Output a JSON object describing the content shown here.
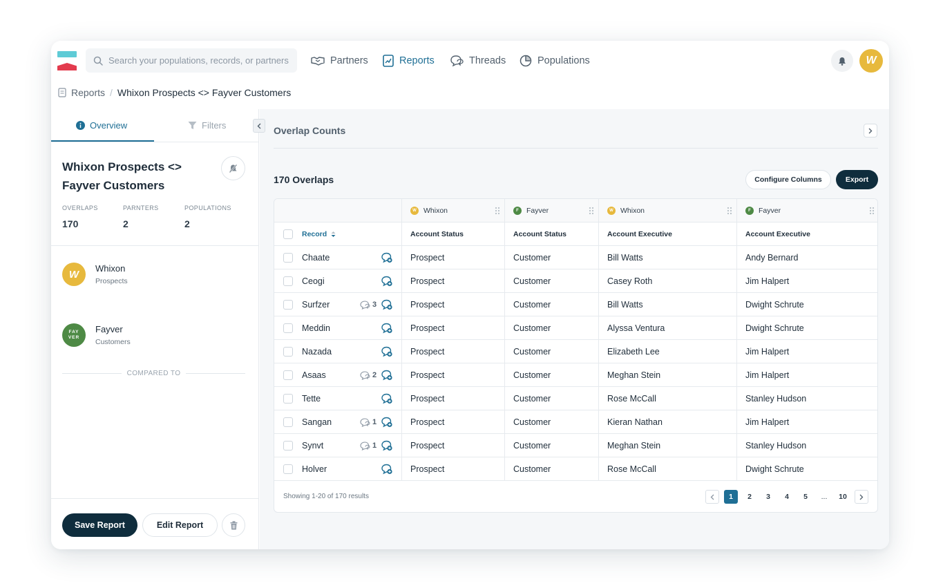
{
  "nav": {
    "search_placeholder": "Search your populations, records, or partners",
    "items": [
      {
        "label": "Partners",
        "icon": "handshake-icon"
      },
      {
        "label": "Reports",
        "icon": "report-chart-icon",
        "active": true
      },
      {
        "label": "Threads",
        "icon": "threads-icon"
      },
      {
        "label": "Populations",
        "icon": "pie-chart-icon"
      }
    ],
    "avatar_letter": "W"
  },
  "breadcrumb": {
    "root": "Reports",
    "current": "Whixon Prospects <> Fayver Customers"
  },
  "left_panel": {
    "tabs": {
      "overview": "Overview",
      "filters": "Filters"
    },
    "title": "Whixon Prospects <> Fayver Customers",
    "stats": [
      {
        "label": "OVERLAPS",
        "value": "170"
      },
      {
        "label": "PARNTERS",
        "value": "2"
      },
      {
        "label": "POPULATIONS",
        "value": "2"
      }
    ],
    "source": {
      "avatar": "W",
      "name": "Whixon",
      "population": "Prospects"
    },
    "compared_to": "COMPARED TO",
    "target": {
      "avatar_line1": "FAY",
      "avatar_line2": "VER",
      "name": "Fayver",
      "population": "Customers"
    },
    "save_label": "Save Report",
    "edit_label": "Edit Report"
  },
  "main": {
    "section_title": "Overlap Counts",
    "overlaps_title": "170 Overlaps",
    "configure_label": "Configure Columns",
    "export_label": "Export",
    "partner_headers": [
      {
        "name": "Whixon",
        "logo": "W"
      },
      {
        "name": "Fayver",
        "logo": "F"
      },
      {
        "name": "Whixon",
        "logo": "W"
      },
      {
        "name": "Fayver",
        "logo": "F"
      }
    ],
    "column_headers": [
      "Record",
      "Account Status",
      "Account Status",
      "Account Executive",
      "Account Executive"
    ],
    "rows": [
      {
        "record": "Chaate",
        "threads": "",
        "ws": "Prospect",
        "fs": "Customer",
        "wae": "Bill Watts",
        "fae": "Andy Bernard"
      },
      {
        "record": "Ceogi",
        "threads": "",
        "ws": "Prospect",
        "fs": "Customer",
        "wae": "Casey Roth",
        "fae": "Jim Halpert"
      },
      {
        "record": "Surfzer",
        "threads": "3",
        "ws": "Prospect",
        "fs": "Customer",
        "wae": "Bill Watts",
        "fae": "Dwight Schrute"
      },
      {
        "record": "Meddin",
        "threads": "",
        "ws": "Prospect",
        "fs": "Customer",
        "wae": "Alyssa Ventura",
        "fae": "Dwight Schrute"
      },
      {
        "record": "Nazada",
        "threads": "",
        "ws": "Prospect",
        "fs": "Customer",
        "wae": "Elizabeth Lee",
        "fae": "Jim Halpert"
      },
      {
        "record": "Asaas",
        "threads": "2",
        "ws": "Prospect",
        "fs": "Customer",
        "wae": "Meghan Stein",
        "fae": "Jim Halpert"
      },
      {
        "record": "Tette",
        "threads": "",
        "ws": "Prospect",
        "fs": "Customer",
        "wae": "Rose McCall",
        "fae": "Stanley Hudson"
      },
      {
        "record": "Sangan",
        "threads": "1",
        "ws": "Prospect",
        "fs": "Customer",
        "wae": "Kieran Nathan",
        "fae": "Jim Halpert"
      },
      {
        "record": "Synvt",
        "threads": "1",
        "ws": "Prospect",
        "fs": "Customer",
        "wae": "Meghan Stein",
        "fae": "Stanley Hudson"
      },
      {
        "record": "Holver",
        "threads": "",
        "ws": "Prospect",
        "fs": "Customer",
        "wae": "Rose McCall",
        "fae": "Dwight Schrute"
      }
    ],
    "pagination": {
      "showing": "Showing 1-20 of 170 results",
      "pages": [
        "1",
        "2",
        "3",
        "4",
        "5",
        "...",
        "10"
      ],
      "current": "1"
    }
  },
  "colors": {
    "accent": "#1f6f95",
    "dark": "#0f2d3d",
    "whixon": "#e7b93d",
    "fayver": "#4e8a45"
  }
}
